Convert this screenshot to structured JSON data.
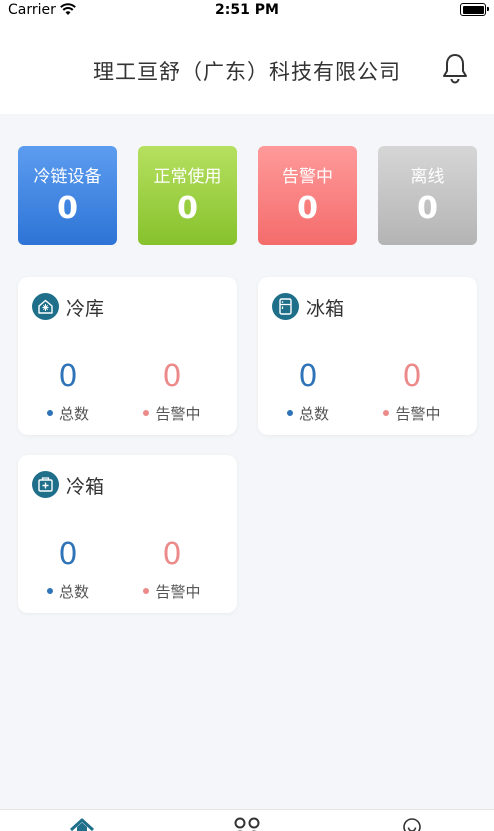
{
  "status_bar": {
    "carrier": "Carrier",
    "time": "2:51 PM"
  },
  "header": {
    "title": "理工亘舒（广东）科技有限公司",
    "bell_icon": "bell-icon"
  },
  "summary": [
    {
      "label": "冷链设备",
      "value": "0",
      "color": "#3f86e0"
    },
    {
      "label": "正常使用",
      "value": "0",
      "color": "#9fd245"
    },
    {
      "label": "告警中",
      "value": "0",
      "color": "#fb8080"
    },
    {
      "label": "离线",
      "value": "0",
      "color": "#c4c4c4"
    }
  ],
  "panels": [
    {
      "title": "冷库",
      "icon": "cold-storage-icon",
      "total": "0",
      "total_label": "总数",
      "alarm": "0",
      "alarm_label": "告警中"
    },
    {
      "title": "冰箱",
      "icon": "fridge-icon",
      "total": "0",
      "total_label": "总数",
      "alarm": "0",
      "alarm_label": "告警中"
    },
    {
      "title": "冷箱",
      "icon": "cold-box-icon",
      "total": "0",
      "total_label": "总数",
      "alarm": "0",
      "alarm_label": "告警中"
    }
  ],
  "tabbar": {
    "icons": [
      "home-icon",
      "apps-icon",
      "user-icon"
    ]
  },
  "colors": {
    "primary": "#1f6f8b",
    "total_blue": "#2f73b8",
    "alarm_red": "#ec8a8a"
  }
}
